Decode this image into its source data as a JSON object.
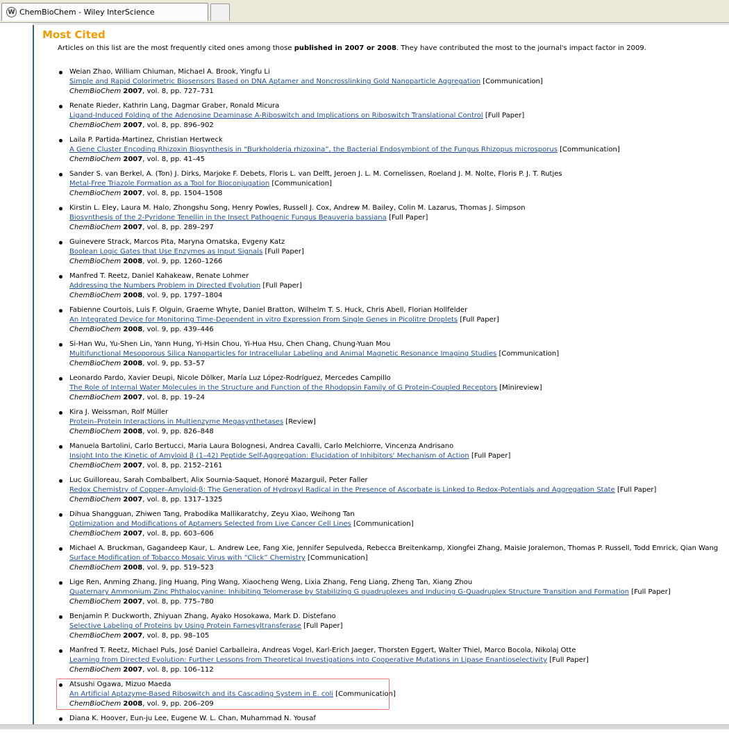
{
  "browser": {
    "tab_title": "ChemBioChem - Wiley InterScience",
    "tab_icon": "wiley-logo-icon"
  },
  "page": {
    "title": "Most Cited",
    "intro_before": "Articles on this list are the most frequently cited ones among those ",
    "intro_bold": "published in 2007 or 2008",
    "intro_after": ". They have contributed the most to the journal's impact factor in 2009."
  },
  "citations": [
    {
      "authors": "Weian Zhao, William Chiuman, Michael A. Brook, Yingfu Li",
      "title": "Simple and Rapid Colorimetric Biosensors Based on DNA Aptamer and Noncrosslinking Gold Nanoparticle Aggregation",
      "type": "[Communication]",
      "journal": "ChemBioChem",
      "year": "2007",
      "details": ", vol. 8, pp. 727–731"
    },
    {
      "authors": "Renate Rieder, Kathrin Lang, Dagmar Graber, Ronald Micura",
      "title": "Ligand-Induced Folding of the Adenosine Deaminase A-Riboswitch and Implications on Riboswitch Translational Control",
      "type": "[Full Paper]",
      "journal": "ChemBioChem",
      "year": "2007",
      "details": ", vol. 8, pp. 896–902"
    },
    {
      "authors": "Laila P. Partida-Martinez, Christian Hertweck",
      "title": "A Gene Cluster Encoding Rhizoxin Biosynthesis in “Burkholderia rhizoxina”, the Bacterial Endosymbiont of the Fungus Rhizopus microsporus",
      "type": "[Communication]",
      "journal": "ChemBioChem",
      "year": "2007",
      "details": ", vol. 8, pp. 41–45"
    },
    {
      "authors": "Sander S. van Berkel, A. (Ton) J. Dirks, Marjoke F. Debets, Floris L. van Delft, Jeroen J. L. M. Cornelissen, Roeland J. M. Nolte, Floris P. J. T. Rutjes",
      "title": "Metal-Free Triazole Formation as a Tool for Bioconjugation",
      "type": "[Communication]",
      "journal": "ChemBioChem",
      "year": "2007",
      "details": ", vol. 8, pp. 1504–1508"
    },
    {
      "authors": "Kirstin L. Eley, Laura M. Halo, Zhongshu Song, Henry Powles, Russell J. Cox, Andrew M. Bailey, Colin M. Lazarus, Thomas J. Simpson",
      "title": "Biosynthesis of the 2-Pyridone Tenellin in the Insect Pathogenic Fungus Beauveria bassiana",
      "type": "[Full Paper]",
      "journal": "ChemBioChem",
      "year": "2007",
      "details": ", vol. 8, pp. 289–297"
    },
    {
      "authors": "Guinevere Strack, Marcos Pita, Maryna Ornatska, Evgeny Katz",
      "title": "Boolean Logic Gates that Use Enzymes as Input Signals",
      "type": "[Full Paper]",
      "journal": "ChemBioChem",
      "year": "2008",
      "details": ", vol. 9, pp. 1260–1266"
    },
    {
      "authors": "Manfred T. Reetz, Daniel Kahakeaw, Renate Lohmer",
      "title": "Addressing the Numbers Problem in Directed Evolution",
      "type": "[Full Paper]",
      "journal": "ChemBioChem",
      "year": "2008",
      "details": ", vol. 9, pp. 1797–1804"
    },
    {
      "authors": "Fabienne Courtois, Luis F. Olguin, Graeme Whyte, Daniel Bratton, Wilhelm T. S. Huck, Chris Abell, Florian Hollfelder",
      "title": "An Integrated Device for Monitoring Time-Dependent in vitro Expression From Single Genes in Picolitre Droplets",
      "type": "[Full Paper]",
      "journal": "ChemBioChem",
      "year": "2008",
      "details": ", vol. 9, pp. 439–446"
    },
    {
      "authors": "Si-Han Wu, Yu-Shen Lin, Yann Hung, Yi-Hsin Chou, Yi-Hua Hsu, Chen Chang, Chung-Yuan Mou",
      "title": "Multifunctional Mesoporous Silica Nanoparticles for Intracellular Labeling and Animal Magnetic Resonance Imaging Studies",
      "type": "[Communication]",
      "journal": "ChemBioChem",
      "year": "2008",
      "details": ", vol. 9, pp. 53–57"
    },
    {
      "authors": "Leonardo Pardo, Xavier Deupi, Nicole Dölker, María Luz López-Rodríguez, Mercedes Campillo",
      "title": "The Role of Internal Water Molecules in the Structure and Function of the Rhodopsin Family of G Protein-Coupled Receptors",
      "type": "[Minireview]",
      "journal": "ChemBioChem",
      "year": "2007",
      "details": ", vol. 8, pp. 19–24"
    },
    {
      "authors": "Kira J. Weissman, Rolf Müller",
      "title": "Protein–Protein Interactions in Multienzyme Megasynthetases",
      "type": "[Review]",
      "journal": "ChemBioChem",
      "year": "2008",
      "details": ", vol. 9, pp. 826–848"
    },
    {
      "authors": "Manuela Bartolini, Carlo Bertucci, Maria Laura Bolognesi, Andrea Cavalli, Carlo Melchiorre, Vincenza Andrisano",
      "title": "Insight Into the Kinetic of Amyloid β (1–42) Peptide Self-Aggregation: Elucidation of Inhibitors' Mechanism of Action",
      "type": "[Full Paper]",
      "journal": "ChemBioChem",
      "year": "2007",
      "details": ", vol. 8, pp. 2152–2161"
    },
    {
      "authors": "Luc Guilloreau, Sarah Combalbert, Alix Sournia-Saquet, Honoré Mazarguil, Peter Faller",
      "title": "Redox Chemistry of Copper–Amyloid-β: The Generation of Hydroxyl Radical in the Presence of Ascorbate is Linked to Redox-Potentials and Aggregation State",
      "type": "[Full Paper]",
      "journal": "ChemBioChem",
      "year": "2007",
      "details": ", vol. 8, pp. 1317–1325"
    },
    {
      "authors": "Dihua Shangguan, Zhiwen Tang, Prabodika Mallikaratchy, Zeyu Xiao, Weihong Tan",
      "title": "Optimization and Modifications of Aptamers Selected from Live Cancer Cell Lines",
      "type": "[Communication]",
      "journal": "ChemBioChem",
      "year": "2007",
      "details": ", vol. 8, pp. 603–606"
    },
    {
      "authors": "Michael A. Bruckman, Gagandeep Kaur, L. Andrew Lee, Fang Xie, Jennifer Sepulveda, Rebecca Breitenkamp, Xiongfei Zhang, Maisie Joralemon, Thomas P. Russell, Todd Emrick, Qian Wang",
      "title": "Surface Modification of Tobacco Mosaic Virus with “Click” Chemistry",
      "type": "[Communication]",
      "journal": "ChemBioChem",
      "year": "2008",
      "details": ", vol. 9, pp. 519–523"
    },
    {
      "authors": "Lige Ren, Anming Zhang, Jing Huang, Ping Wang, Xiaocheng Weng, Lixia Zhang, Feng Liang, Zheng Tan, Xiang Zhou",
      "title": "Quaternary Ammonium Zinc Phthalocyanine: Inhibiting Telomerase by Stabilizing G quadruplexes and Inducing G-Quadruplex Structure Transition and Formation",
      "type": "[Full Paper]",
      "journal": "ChemBioChem",
      "year": "2007",
      "details": ", vol. 8, pp. 775–780"
    },
    {
      "authors": "Benjamin P. Duckworth, Zhiyuan Zhang, Ayako Hosokawa, Mark D. Distefano",
      "title": "Selective Labeling of Proteins by Using Protein Farnesyltransferase",
      "type": "[Full Paper]",
      "journal": "ChemBioChem",
      "year": "2007",
      "details": ", vol. 8, pp. 98–105"
    },
    {
      "authors": "Manfred T. Reetz, Michael Puls, José Daniel Carballeira, Andreas Vogel, Karl-Erich Jaeger, Thorsten Eggert, Walter Thiel, Marco Bocola, Nikolaj Otte",
      "title": "Learning from Directed Evolution: Further Lessons from Theoretical Investigations into Cooperative Mutations in Lipase Enantioselectivity",
      "type": "[Full Paper]",
      "journal": "ChemBioChem",
      "year": "2007",
      "details": ", vol. 8, pp. 106–112"
    },
    {
      "authors": "Atsushi Ogawa, Mizuo Maeda",
      "title": "An Artificial Aptazyme-Based Riboswitch and its Cascading System in E. coli",
      "type": "[Communication]",
      "journal": "ChemBioChem",
      "year": "2008",
      "details": ", vol. 9, pp. 206–209"
    },
    {
      "authors": "Diana K. Hoover, Eun-ju Lee, Eugene W. L. Chan, Muhammad N. Yousaf",
      "title": "",
      "type": "",
      "journal": "",
      "year": "",
      "details": ""
    }
  ],
  "highlight_color": "#f07070",
  "accent_color": "#f39c00",
  "link_color": "#1f4e9a"
}
